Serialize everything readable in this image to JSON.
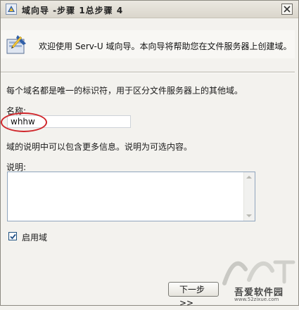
{
  "window": {
    "title": "域向导 -步骤 1总步骤 4"
  },
  "banner": {
    "text": "欢迎使用 Serv-U 域向导。本向导将帮助您在文件服务器上创建域。"
  },
  "form": {
    "intro": "每个域名都是唯一的标识符，用于区分文件服务器上的其他域。",
    "name_label": "名称:",
    "name_value": "whhw",
    "description_intro": "域的说明中可以包含更多信息。说明为可选内容。",
    "description_label": "说明:",
    "description_value": "",
    "enable_label": "启用域",
    "enable_checked": true
  },
  "buttons": {
    "next_label": "下一步>>"
  },
  "watermark": {
    "site_name": "吾爱软件园",
    "url": "www.52zixue.com"
  },
  "colors": {
    "highlight": "#d0262b"
  }
}
